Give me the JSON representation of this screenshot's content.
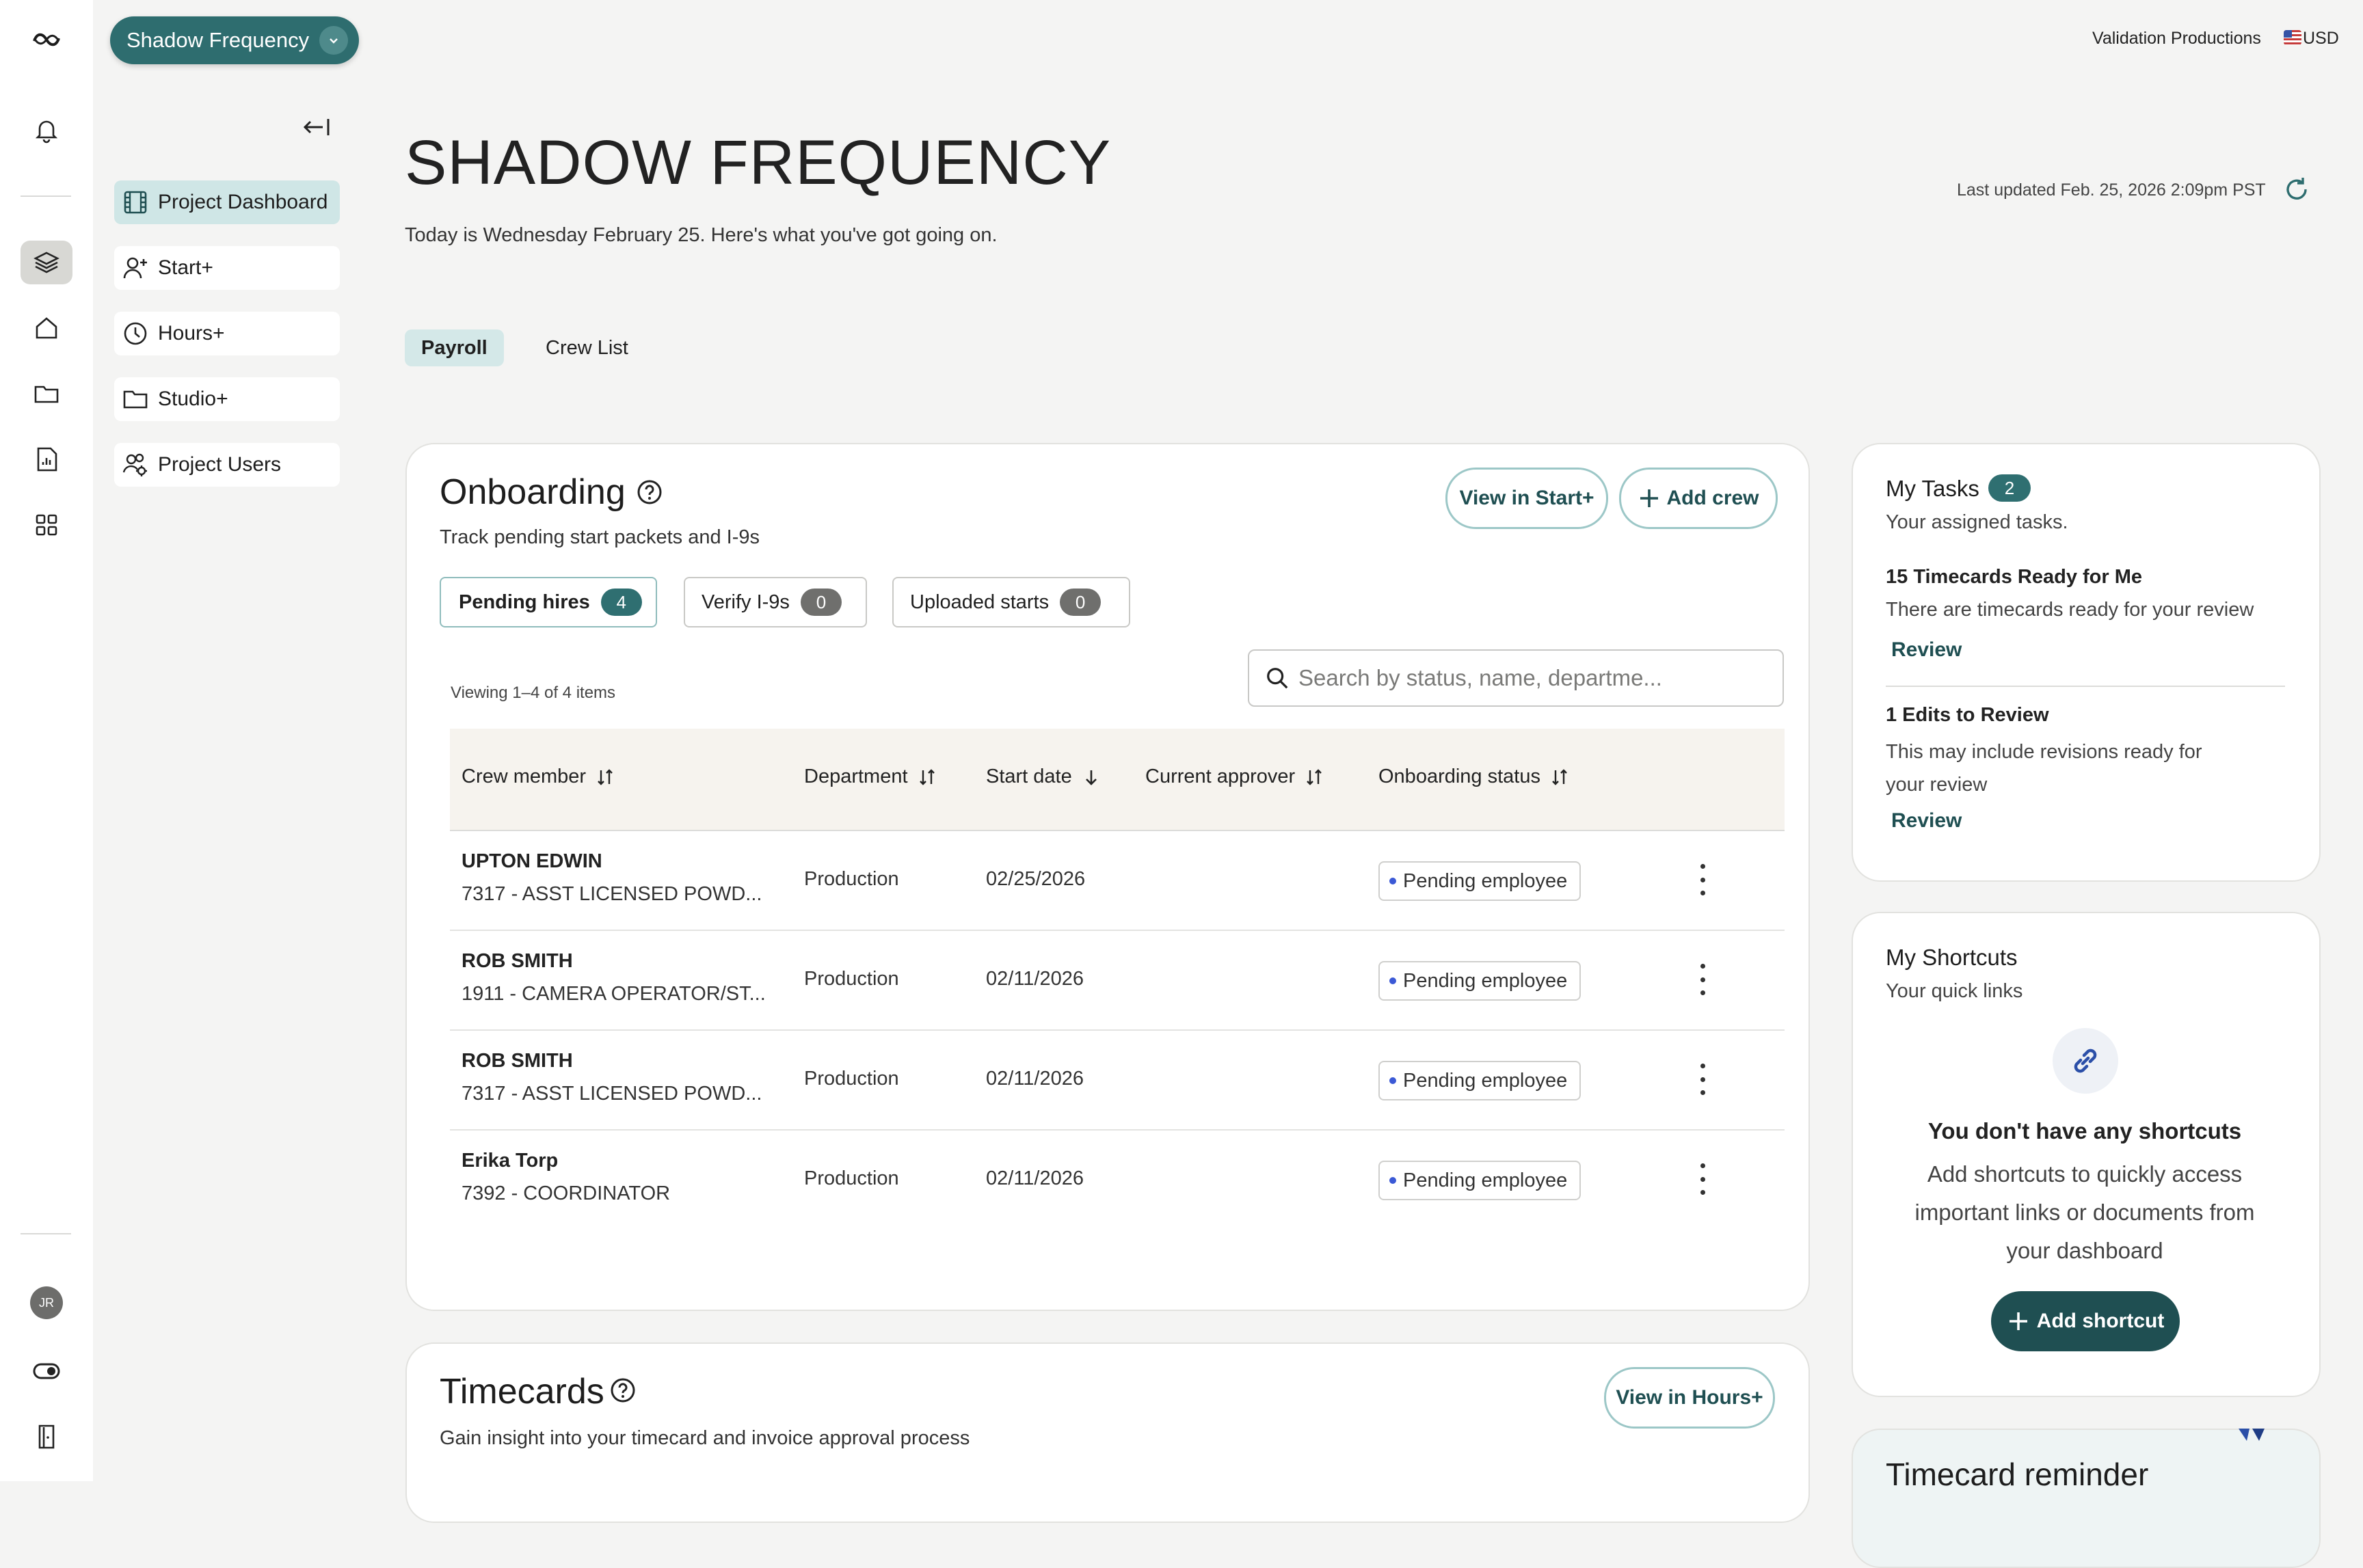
{
  "app": {
    "project_selector": "Shadow Frequency",
    "company": "Validation Productions",
    "currency": "USD"
  },
  "sidebar_nav": [
    {
      "label": "Project Dashboard",
      "icon": "film-icon",
      "active": true
    },
    {
      "label": "Start+",
      "icon": "user-add-icon",
      "active": false
    },
    {
      "label": "Hours+",
      "icon": "clock-icon",
      "active": false
    },
    {
      "label": "Studio+",
      "icon": "folder-icon",
      "active": false
    },
    {
      "label": "Project Users",
      "icon": "users-gear-icon",
      "active": false
    }
  ],
  "rail": {
    "avatar_initials": "JR"
  },
  "header": {
    "title": "SHADOW FREQUENCY",
    "subtitle": "Today is Wednesday February 25. Here's what you've got going on.",
    "last_updated": "Last updated Feb. 25, 2026 2:09pm PST"
  },
  "tabs": [
    "Payroll",
    "Crew List"
  ],
  "onboarding": {
    "title": "Onboarding",
    "subtitle": "Track pending start packets and I-9s",
    "view_button": "View in Start+",
    "add_button": "Add crew",
    "chips": [
      {
        "label": "Pending hires",
        "count": "4"
      },
      {
        "label": "Verify I-9s",
        "count": "0"
      },
      {
        "label": "Uploaded starts",
        "count": "0"
      }
    ],
    "viewing": "Viewing 1–4 of 4 items",
    "search_placeholder": "Search by status, name, departme...",
    "columns": [
      "Crew member",
      "Department",
      "Start date",
      "Current approver",
      "Onboarding status"
    ],
    "rows": [
      {
        "name": "UPTON EDWIN",
        "role": "7317 - ASST LICENSED POWD...",
        "department": "Production",
        "start_date": "02/25/2026",
        "approver": "",
        "status": "Pending employee"
      },
      {
        "name": "ROB SMITH",
        "role": "1911 - CAMERA OPERATOR/ST...",
        "department": "Production",
        "start_date": "02/11/2026",
        "approver": "",
        "status": "Pending employee"
      },
      {
        "name": "ROB SMITH",
        "role": "7317 - ASST LICENSED POWD...",
        "department": "Production",
        "start_date": "02/11/2026",
        "approver": "",
        "status": "Pending employee"
      },
      {
        "name": "Erika Torp",
        "role": "7392 - COORDINATOR",
        "department": "Production",
        "start_date": "02/11/2026",
        "approver": "",
        "status": "Pending employee"
      }
    ]
  },
  "timecards": {
    "title": "Timecards",
    "subtitle": "Gain insight into your timecard and invoice approval process",
    "view_button": "View in Hours+"
  },
  "tasks": {
    "title": "My Tasks",
    "count": "2",
    "subtitle": "Your assigned tasks.",
    "items": [
      {
        "title": "15 Timecards Ready for Me",
        "desc": "There are timecards ready for your review",
        "link": "Review"
      },
      {
        "title": "1 Edits to Review",
        "desc": "This may include revisions ready for your review",
        "link": "Review"
      }
    ]
  },
  "shortcuts": {
    "title": "My Shortcuts",
    "subtitle": "Your quick links",
    "empty_title": "You don't have any shortcuts",
    "empty_desc": "Add shortcuts to quickly access important links or documents from your dashboard",
    "add_button": "Add shortcut"
  },
  "reminder": {
    "title": "Timecard reminder"
  },
  "colors": {
    "accent": "#2e6d6f",
    "accent_light": "#cfe6e6",
    "dark_button": "#1f4f52",
    "status_dot": "#3b59d6"
  }
}
